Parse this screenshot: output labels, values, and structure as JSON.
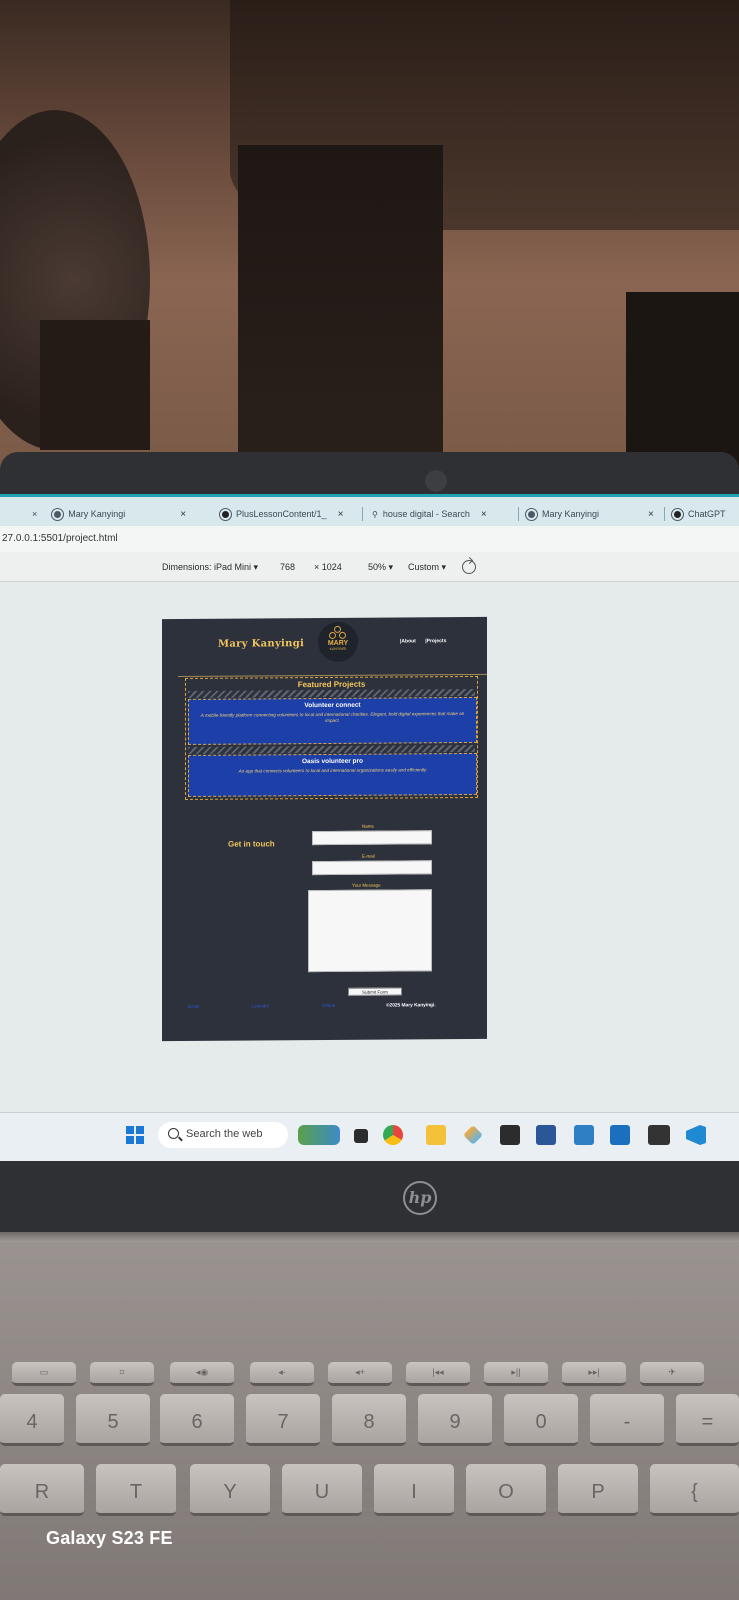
{
  "browser": {
    "tabs": [
      {
        "label": "Mary Kanyingi"
      },
      {
        "label": "PlusLessonContent/1_"
      },
      {
        "label": "house digital - Search"
      },
      {
        "label": "Mary Kanyingi"
      },
      {
        "label": "ChatGPT"
      }
    ],
    "close_glyph": "×",
    "url": "27.0.0.1:5501/project.html"
  },
  "devtools": {
    "dimensions_label": "Dimensions: iPad Mini ▾",
    "width": "768",
    "height_label": "× 1024",
    "zoom": "50% ▾",
    "throttle": "Custom ▾"
  },
  "site": {
    "name": "Mary Kanyingi",
    "logo_text": "MARY",
    "logo_sub": "KANYINGI",
    "nav": [
      "|About",
      "|Projects"
    ],
    "projects_title": "Featured Projects",
    "projects": [
      {
        "title": "Volunteer connect",
        "description": "A mobile friendly platform connecting volunteers to local and international charities. Elegant, bold digital experiences that make an impact."
      },
      {
        "title": "Oasis volunteer pro",
        "description": "An app that connects volunteers to local and international organizations easily and efficiently"
      }
    ],
    "contact_title": "Get in touch",
    "form": {
      "name_label": "Name",
      "email_label": "E-mail",
      "message_label": "Your Message",
      "submit_label": "Submit Form"
    },
    "footer_links": [
      "Email",
      "LinkedIn",
      "Github"
    ],
    "copyright": "©2025 Mary Kanyingi."
  },
  "taskbar": {
    "search_placeholder": "Search the web",
    "icons": [
      "windows-start-icon",
      "widgets-icon",
      "task-view-icon",
      "chrome-icon",
      "file-explorer-icon",
      "git-icon",
      "sticky-notes-icon",
      "word-icon",
      "photos-icon",
      "outlook-icon",
      "terminal-icon",
      "vscode-icon"
    ]
  },
  "device": {
    "brand_logo": "hp",
    "phone_watermark": "Galaxy S23 FE"
  },
  "keyboard": {
    "number_row": [
      "4",
      "5",
      "6",
      "7",
      "8",
      "9",
      "0",
      "-",
      "="
    ],
    "letter_row": [
      "R",
      "T",
      "Y",
      "U",
      "I",
      "O",
      "P",
      "{"
    ]
  },
  "colors": {
    "page_bg": "#2c313c",
    "accent_gold": "#f3c55b",
    "project_blue": "#1c3fa8",
    "browser_accent": "#22a2b5"
  }
}
